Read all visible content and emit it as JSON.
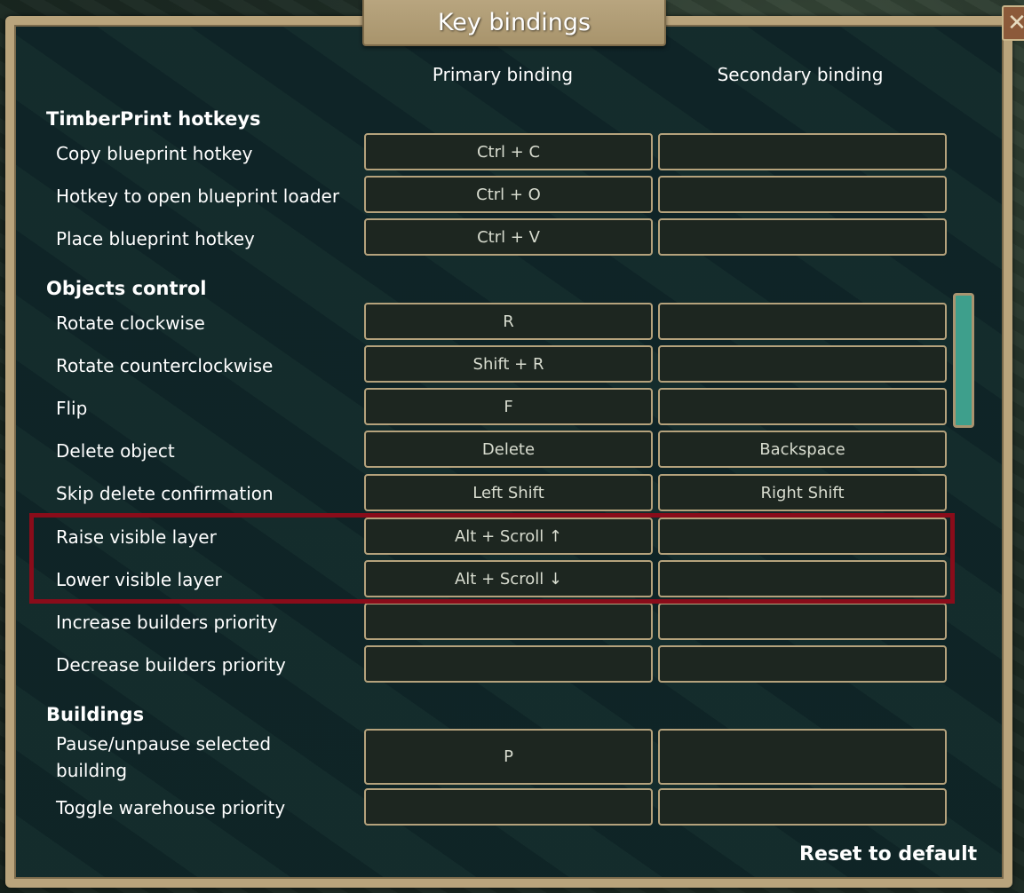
{
  "window": {
    "title": "Key bindings",
    "close_icon": "close-icon"
  },
  "columns": {
    "primary": "Primary binding",
    "secondary": "Secondary binding"
  },
  "sections": [
    {
      "title": "TimberPrint hotkeys",
      "rows": [
        {
          "label": "Copy blueprint hotkey",
          "primary": "Ctrl + C",
          "secondary": ""
        },
        {
          "label": "Hotkey to open blueprint loader",
          "primary": "Ctrl + O",
          "secondary": ""
        },
        {
          "label": "Place blueprint hotkey",
          "primary": "Ctrl + V",
          "secondary": ""
        }
      ]
    },
    {
      "title": "Objects control",
      "rows": [
        {
          "label": "Rotate clockwise",
          "primary": "R",
          "secondary": ""
        },
        {
          "label": "Rotate counterclockwise",
          "primary": "Shift + R",
          "secondary": ""
        },
        {
          "label": "Flip",
          "primary": "F",
          "secondary": ""
        },
        {
          "label": "Delete object",
          "primary": "Delete",
          "secondary": "Backspace"
        },
        {
          "label": "Skip delete confirmation",
          "primary": "Left Shift",
          "secondary": "Right Shift"
        },
        {
          "label": "Raise visible layer",
          "primary": "Alt + Scroll ↑",
          "secondary": ""
        },
        {
          "label": "Lower visible layer",
          "primary": "Alt + Scroll ↓",
          "secondary": ""
        },
        {
          "label": "Increase builders priority",
          "primary": "",
          "secondary": ""
        },
        {
          "label": "Decrease builders priority",
          "primary": "",
          "secondary": ""
        }
      ]
    },
    {
      "title": "Buildings",
      "rows": [
        {
          "label": "Pause/unpause selected building",
          "primary": "P",
          "secondary": ""
        },
        {
          "label": "Toggle warehouse priority",
          "primary": "",
          "secondary": ""
        }
      ]
    }
  ],
  "footer": {
    "reset_label": "Reset to default"
  },
  "colors": {
    "highlight": "#8a0c1a",
    "scrollbar": "#3e9f8c",
    "frame": "#b9a47c"
  }
}
